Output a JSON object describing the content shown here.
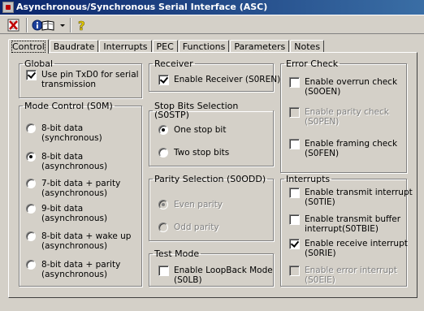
{
  "window": {
    "title": "Asynchronous/Synchronous Serial Interface (ASC)"
  },
  "toolbar": {
    "icons": [
      "close-document-icon",
      "info-book-icon",
      "dropdown-arrow-icon",
      "help-question-icon"
    ]
  },
  "tabs": [
    {
      "label": "Control",
      "active": true
    },
    {
      "label": "Baudrate"
    },
    {
      "label": "Interrupts"
    },
    {
      "label": "PEC"
    },
    {
      "label": "Functions"
    },
    {
      "label": "Parameters"
    },
    {
      "label": "Notes"
    }
  ],
  "global": {
    "title": "Global",
    "use_pin": {
      "label": "Use pin TxD0 for serial\ntransmission",
      "checked": true
    }
  },
  "mode_control": {
    "title": "Mode Control (S0M)",
    "options": [
      {
        "label": "8-bit data\n(synchronous)",
        "checked": false
      },
      {
        "label": "8-bit data\n(asynchronous)",
        "checked": true
      },
      {
        "label": "7-bit data + parity\n(asynchronous)",
        "checked": false
      },
      {
        "label": "9-bit data\n(asynchronous)",
        "checked": false
      },
      {
        "label": "8-bit data + wake up\n(asynchronous)",
        "checked": false
      },
      {
        "label": "8-bit data + parity\n(asynchronous)",
        "checked": false
      }
    ]
  },
  "receiver": {
    "title": "Receiver",
    "enable": {
      "label": "Enable Receiver (S0REN)",
      "checked": true
    }
  },
  "stop_bits": {
    "title": "Stop Bits Selection (S0STP)",
    "options": [
      {
        "label": "One stop bit",
        "checked": true
      },
      {
        "label": "Two stop bits",
        "checked": false
      }
    ]
  },
  "parity": {
    "title": "Parity Selection (S0ODD)",
    "options": [
      {
        "label": "Even parity",
        "checked": true,
        "disabled": true
      },
      {
        "label": "Odd parity",
        "checked": false,
        "disabled": true
      }
    ]
  },
  "test_mode": {
    "title": "Test Mode",
    "loopback": {
      "label": "Enable LoopBack Mode\n(S0LB)",
      "checked": false
    }
  },
  "error_check": {
    "title": "Error Check",
    "overrun": {
      "label": "Enable overrun check\n(S0OEN)",
      "checked": false
    },
    "parity": {
      "label": "Enable parity check\n(S0PEN)",
      "checked": false,
      "disabled": true
    },
    "framing": {
      "label": "Enable framing check\n(S0FEN)",
      "checked": false
    }
  },
  "interrupts": {
    "title": "Interrupts",
    "transmit": {
      "label": "Enable transmit interrupt\n(S0TIE)",
      "checked": false
    },
    "transmit_buffer": {
      "label": "Enable transmit buffer\ninterrupt(S0TBIE)",
      "checked": false
    },
    "receive": {
      "label": "Enable receive interrupt\n(S0RIE)",
      "checked": true
    },
    "error": {
      "label": "Enable error interrupt\n(S0EIE)",
      "checked": false,
      "disabled": true
    }
  }
}
